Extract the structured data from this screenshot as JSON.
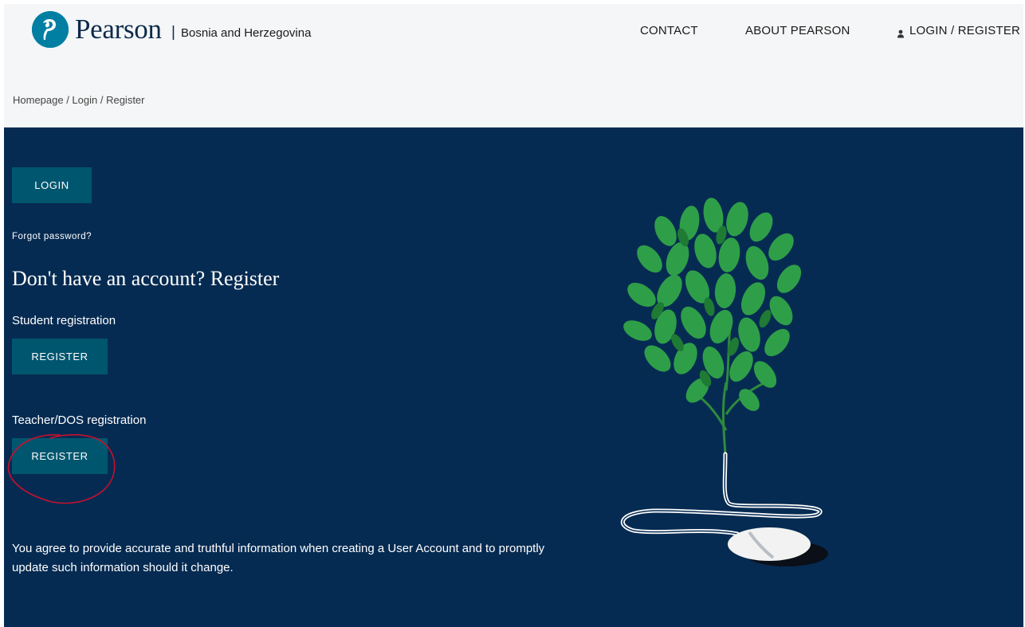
{
  "header": {
    "brand": "Pearson",
    "separator": "|",
    "region": "Bosnia and Herzegovina",
    "nav": {
      "contact": "CONTACT",
      "about": "ABOUT PEARSON",
      "login": "LOGIN / REGISTER"
    }
  },
  "breadcrumb": "Homepage / Login / Register",
  "login": {
    "button": "LOGIN",
    "forgot": "Forgot password?"
  },
  "register": {
    "heading": "Don't have an account? Register",
    "student_label": "Student registration",
    "student_button": "REGISTER",
    "teacher_label": "Teacher/DOS registration",
    "teacher_button": "REGISTER"
  },
  "disclaimer": "You agree to provide accurate and truthful information when creating a User Account and to promptly update such information should it change.",
  "icons": {
    "logo": "pearson-logo-icon",
    "user": "user-icon",
    "illustration": "tree-mouse-illustration"
  },
  "colors": {
    "hero_bg": "#062b52",
    "button_bg": "#00566f",
    "logo_blue": "#007fa3",
    "annotation": "#c8102e"
  }
}
